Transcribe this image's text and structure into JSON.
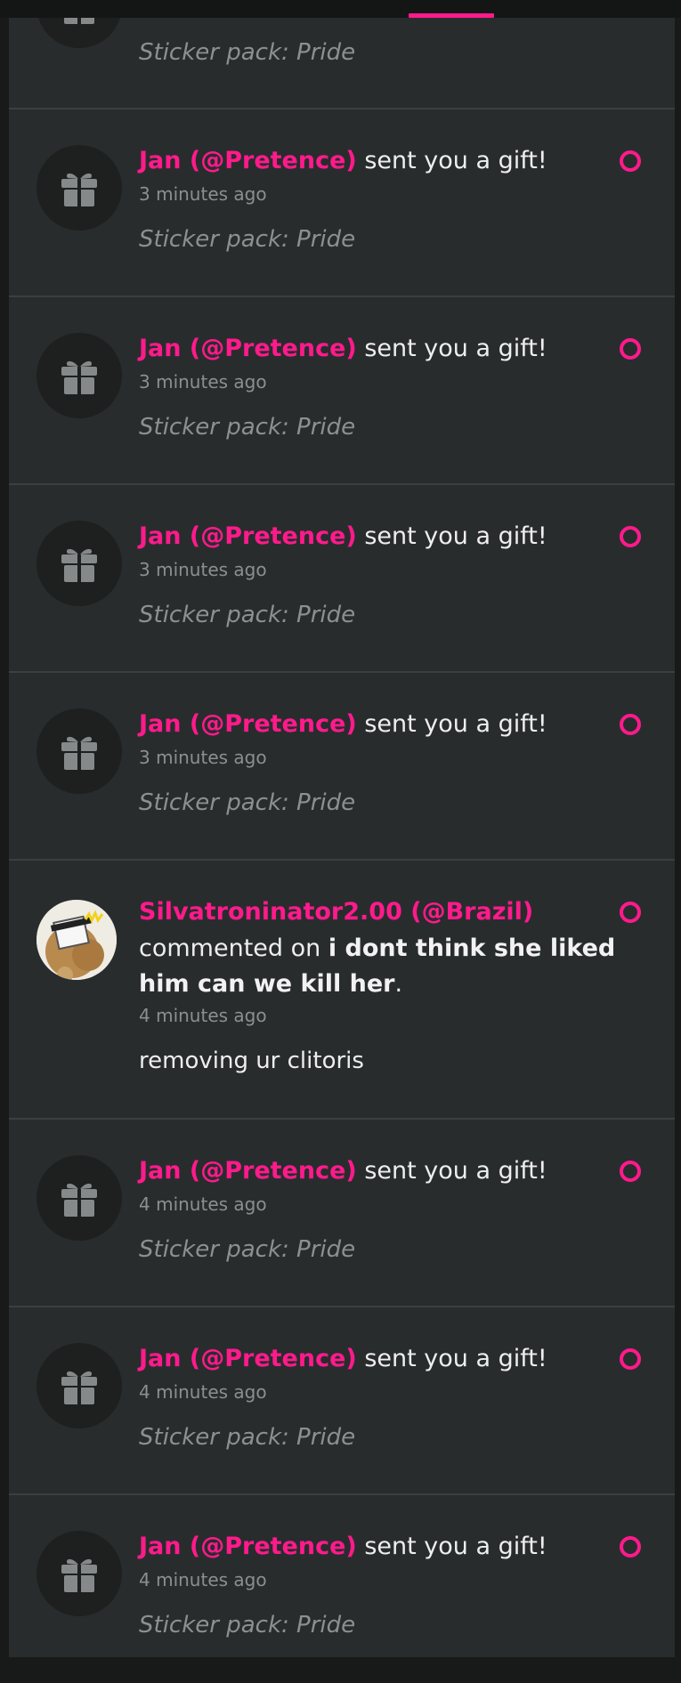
{
  "gift_sender": "Jan (@Pretence)",
  "gift_action": "sent you a gift!",
  "gift_item": "Sticker pack: Pride",
  "colors": {
    "accent": "#ff1a8c",
    "panel": "#292c2d",
    "divider": "#3b3f41"
  },
  "icons": {
    "gift": "gift-icon",
    "unread": "unread-dot-icon"
  },
  "notifications": [
    {
      "type": "gift",
      "time": ""
    },
    {
      "type": "gift",
      "time": "3 minutes ago"
    },
    {
      "type": "gift",
      "time": "3 minutes ago"
    },
    {
      "type": "gift",
      "time": "3 minutes ago"
    },
    {
      "type": "gift",
      "time": "3 minutes ago"
    },
    {
      "type": "comment",
      "user": "Silvatroninator2.00 (@Brazil)",
      "action": "commented on",
      "post_title": "i dont think she liked him can we kill her",
      "post_title_line1": "i dont think she liked",
      "post_title_line2": "him can we kill her",
      "punct": ".",
      "time": "4 minutes ago",
      "body": "removing ur clitoris"
    },
    {
      "type": "gift",
      "time": "4 minutes ago"
    },
    {
      "type": "gift",
      "time": "4 minutes ago"
    },
    {
      "type": "gift",
      "time": "4 minutes ago"
    }
  ]
}
